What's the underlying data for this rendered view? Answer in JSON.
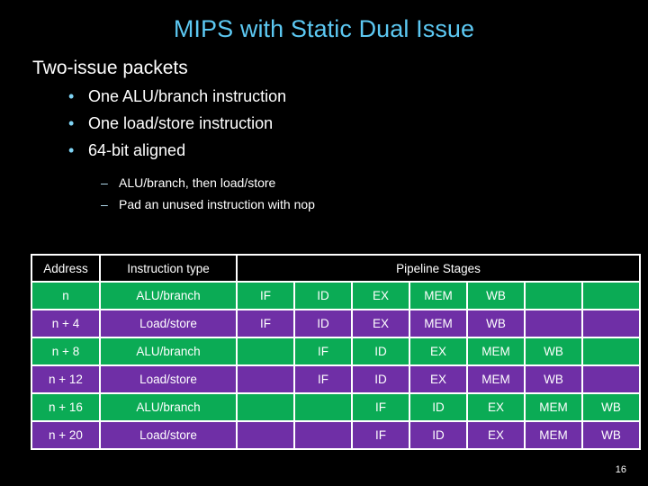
{
  "slide": {
    "title": "MIPS with Static Dual Issue",
    "page_number": "16",
    "background_color": "#000000",
    "title_color": "#5CC8F2",
    "body_text_color": "#FFFFFF",
    "bullet_color": "#7FD4F5",
    "table_green": "#0BAB55",
    "table_purple": "#6F2FA6",
    "table_header_bg": "#000000",
    "table_gridline": "#FFFFFF"
  },
  "body": {
    "heading": "Two-issue packets",
    "bullets": [
      {
        "marker": "•",
        "text": "One ALU/branch instruction"
      },
      {
        "marker": "•",
        "text": "One load/store instruction"
      },
      {
        "marker": "•",
        "text": "64-bit aligned"
      }
    ],
    "sub_bullets": [
      {
        "marker": "–",
        "text": "ALU/branch, then load/store"
      },
      {
        "marker": "–",
        "text": "Pad an unused instruction with nop"
      }
    ]
  },
  "table": {
    "headers": {
      "address": "Address",
      "instruction_type": "Instruction type",
      "pipeline_stages": "Pipeline Stages"
    },
    "stage_column_count": 7,
    "rows": [
      {
        "address": "n",
        "instruction_type": "ALU/branch",
        "color": "green",
        "stages": [
          "IF",
          "ID",
          "EX",
          "MEM",
          "WB",
          "",
          ""
        ]
      },
      {
        "address": "n + 4",
        "instruction_type": "Load/store",
        "color": "purple",
        "stages": [
          "IF",
          "ID",
          "EX",
          "MEM",
          "WB",
          "",
          ""
        ]
      },
      {
        "address": "n + 8",
        "instruction_type": "ALU/branch",
        "color": "green",
        "stages": [
          "",
          "IF",
          "ID",
          "EX",
          "MEM",
          "WB",
          ""
        ]
      },
      {
        "address": "n + 12",
        "instruction_type": "Load/store",
        "color": "purple",
        "stages": [
          "",
          "IF",
          "ID",
          "EX",
          "MEM",
          "WB",
          ""
        ]
      },
      {
        "address": "n + 16",
        "instruction_type": "ALU/branch",
        "color": "green",
        "stages": [
          "",
          "",
          "IF",
          "ID",
          "EX",
          "MEM",
          "WB"
        ]
      },
      {
        "address": "n + 20",
        "instruction_type": "Load/store",
        "color": "purple",
        "stages": [
          "",
          "",
          "IF",
          "ID",
          "EX",
          "MEM",
          "WB"
        ]
      }
    ]
  }
}
